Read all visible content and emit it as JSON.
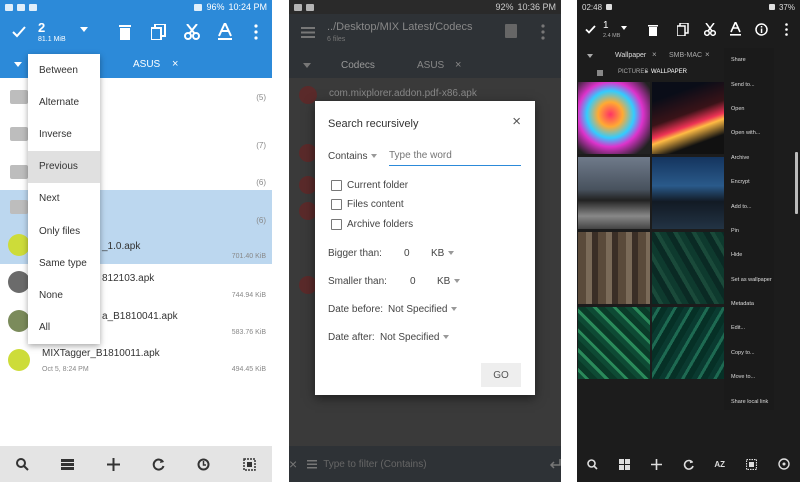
{
  "p1": {
    "status": {
      "time": "10:24 PM",
      "battery": "96%"
    },
    "selection": {
      "count": "2",
      "size": "81.1 MiB"
    },
    "tab_asus": "ASUS",
    "menu": [
      "Between",
      "Alternate",
      "Inverse",
      "Previous",
      "Next",
      "Only files",
      "Same type",
      "None",
      "All"
    ],
    "rows": [
      {
        "count": "(5)"
      },
      {
        "count": "(7)"
      },
      {
        "count": "(6)"
      },
      {
        "count": "(6)"
      },
      {
        "name": "_1.0.apk",
        "size": "701.40 KiB"
      },
      {
        "name": "812103.apk",
        "size": "744.94 KiB"
      },
      {
        "name": "a_B1810041.apk",
        "size": "583.76 KiB"
      },
      {
        "name": "MIXTagger_B1810011.apk",
        "date": "Oct 5, 8:24 PM",
        "size": "494.45 KiB"
      }
    ]
  },
  "p2": {
    "status": {
      "time": "10:36 PM",
      "battery": "92%"
    },
    "path": "../Desktop/MIX Latest/Codecs",
    "subtitle": "6 files",
    "tabs": [
      "Codecs",
      "ASUS"
    ],
    "bg_file": "com.mixplorer.addon.pdf-x86.apk",
    "dialog": {
      "title": "Search recursively",
      "mode": "Contains",
      "placeholder": "Type the word",
      "options": [
        "Current folder",
        "Files content",
        "Archive folders"
      ],
      "bigger_label": "Bigger than:",
      "bigger_value": "0",
      "bigger_unit": "KB",
      "smaller_label": "Smaller than:",
      "smaller_value": "0",
      "smaller_unit": "KB",
      "before_label": "Date before:",
      "before_value": "Not Specified",
      "after_label": "Date after:",
      "after_value": "Not Specified",
      "go": "GO"
    },
    "filter_placeholder": "Type to filter (Contains)"
  },
  "p3": {
    "status": {
      "time": "02:48",
      "battery": "37%"
    },
    "selection": {
      "count": "1",
      "size": "2.4 MB"
    },
    "tabs": [
      "Wallpaper",
      "SMB-MAC"
    ],
    "crumb": [
      "PICTURES",
      "WALLPAPER"
    ],
    "menu": [
      "Share",
      "Send to...",
      "Open",
      "Open with...",
      "Archive",
      "Encrypt",
      "Add to...",
      "Pin",
      "Hide",
      "Set as wallpaper",
      "Metadata",
      "Edit...",
      "Copy to...",
      "Move to...",
      "Share local link"
    ],
    "sort_label": "AZ"
  }
}
